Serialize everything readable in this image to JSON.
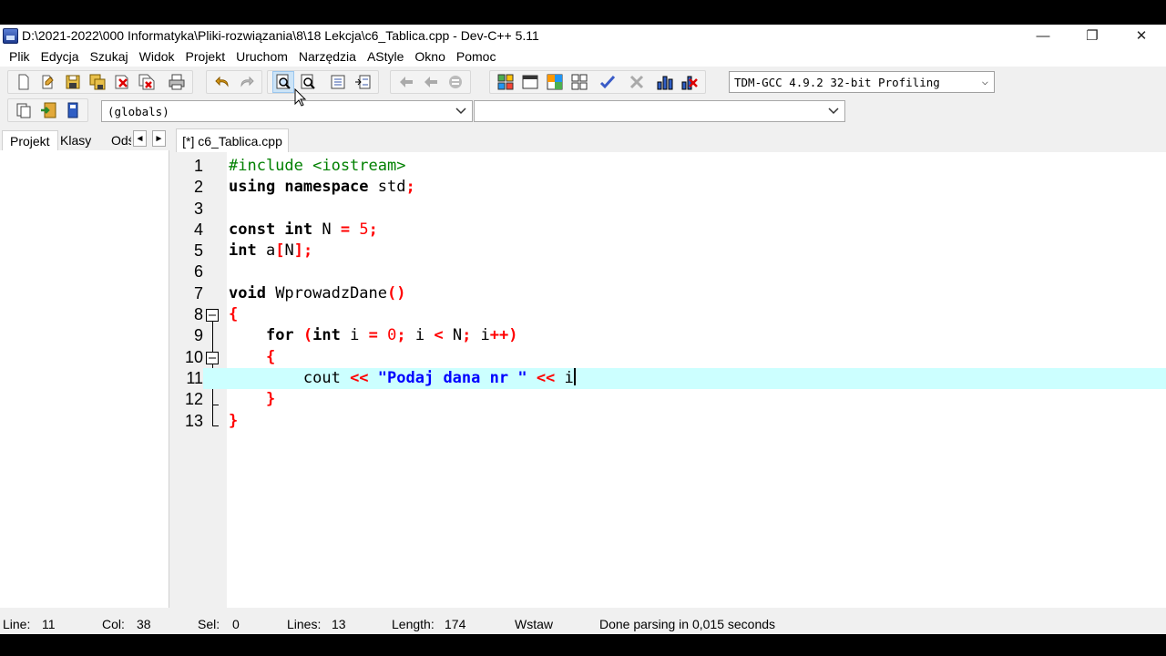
{
  "window": {
    "title": "D:\\2021-2022\\000 Informatyka\\Pliki-rozwiązania\\8\\18 Lekcja\\c6_Tablica.cpp - Dev-C++ 5.11",
    "minimize": "—",
    "restore": "❐",
    "close": "✕"
  },
  "menu": [
    "Plik",
    "Edycja",
    "Szukaj",
    "Widok",
    "Projekt",
    "Uruchom",
    "Narzędzia",
    "AStyle",
    "Okno",
    "Pomoc"
  ],
  "toolbar": {
    "compiler": "TDM-GCC 4.9.2 32-bit Profiling",
    "globals": "(globals)",
    "member": ""
  },
  "left_panel": {
    "tabs": [
      "Projekt",
      "Klasy",
      "Odś"
    ],
    "scroll_left": "◄",
    "scroll_right": "►"
  },
  "editor": {
    "tab_label": "[*] c6_Tablica.cpp",
    "line_numbers": [
      "1",
      "2",
      "3",
      "4",
      "5",
      "6",
      "7",
      "8",
      "9",
      "10",
      "11",
      "12",
      "13"
    ],
    "lines": [
      "#include <iostream>",
      "using namespace std;",
      "",
      "const int N = 5;",
      "int a[N];",
      "",
      "void WprowadzDane()",
      "{",
      "    for (int i = 0; i < N; i++)",
      "    {",
      "        cout << \"Podaj dana nr \" << i",
      "    }",
      "}"
    ],
    "current_line": 11
  },
  "status": {
    "line_label": "Line:",
    "line_value": "11",
    "col_label": "Col:",
    "col_value": "38",
    "sel_label": "Sel:",
    "sel_value": "0",
    "lines_label": "Lines:",
    "lines_value": "13",
    "length_label": "Length:",
    "length_value": "174",
    "mode": "Wstaw",
    "message": "Done parsing in 0,015 seconds"
  },
  "colors": {
    "current_line": "#ccffff",
    "preprocessor": "#008000",
    "number": "#ff0000",
    "string": "#0000ff"
  }
}
